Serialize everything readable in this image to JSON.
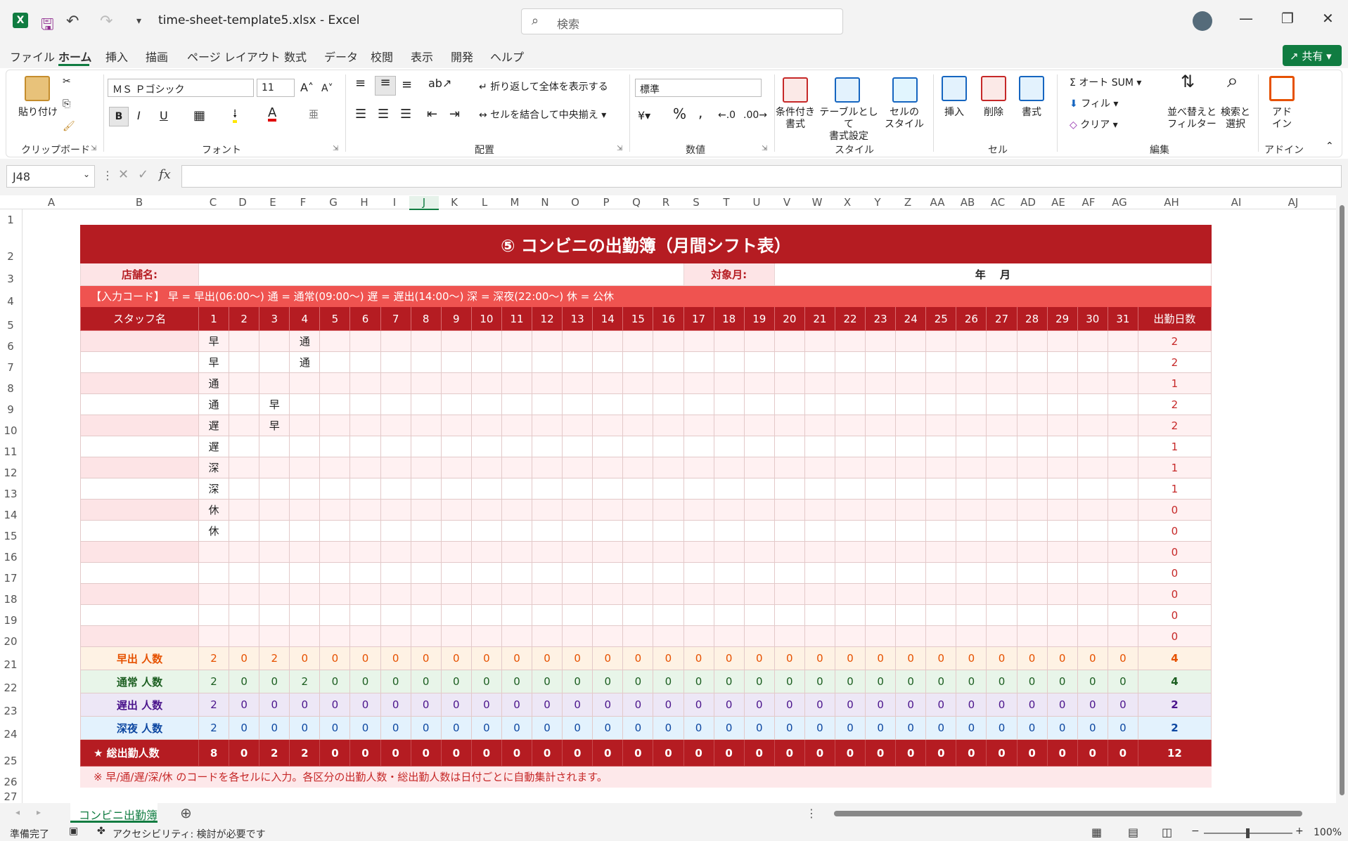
{
  "window": {
    "doc_title": "time-sheet-template5.xlsx  -  Excel",
    "search_placeholder": "検索"
  },
  "menu": [
    "ファイル",
    "ホーム",
    "挿入",
    "描画",
    "ページ レイアウト",
    "数式",
    "データ",
    "校閲",
    "表示",
    "開発",
    "ヘルプ"
  ],
  "share_label": "共有",
  "ribbon": {
    "clipboard": {
      "paste": "貼り付け",
      "label": "クリップボード"
    },
    "font": {
      "name": "ＭＳ Ｐゴシック",
      "size": "11",
      "label": "フォント",
      "bold": "B",
      "italic": "I",
      "underline": "U"
    },
    "alignment": {
      "wrap": "折り返して全体を表示する",
      "merge": "セルを結合して中央揃え",
      "label": "配置"
    },
    "number": {
      "format": "標準",
      "label": "数値"
    },
    "styles": {
      "cond": "条件付き\n書式",
      "table": "テーブルとして\n書式設定",
      "cell": "セルの\nスタイル",
      "label": "スタイル"
    },
    "cells": {
      "insert": "挿入",
      "delete": "削除",
      "format": "書式",
      "label": "セル"
    },
    "editing": {
      "autosum": "オート SUM",
      "fill": "フィル",
      "clear": "クリア",
      "sort": "並べ替えと\nフィルター",
      "find": "検索と\n選択",
      "label": "編集"
    },
    "addins": {
      "btn": "アド\nイン",
      "label": "アドイン"
    }
  },
  "namebox": "J48",
  "columns": [
    "A",
    "B",
    "C",
    "D",
    "E",
    "F",
    "G",
    "H",
    "I",
    "J",
    "K",
    "L",
    "M",
    "N",
    "O",
    "P",
    "Q",
    "R",
    "S",
    "T",
    "U",
    "V",
    "W",
    "X",
    "Y",
    "Z",
    "AA",
    "AB",
    "AC",
    "AD",
    "AE",
    "AF",
    "AG",
    "AH",
    "AI",
    "AJ"
  ],
  "rows": [
    "1",
    "2",
    "3",
    "4",
    "5",
    "6",
    "7",
    "8",
    "9",
    "10",
    "11",
    "12",
    "13",
    "14",
    "15",
    "16",
    "17",
    "18",
    "19",
    "20",
    "21",
    "22",
    "23",
    "24",
    "25",
    "26",
    "27"
  ],
  "sheet": {
    "title": "⑤ コンビニの出勤簿（月間シフト表）",
    "store_label": "店舗名:",
    "month_label": "対象月:",
    "year_month": "年　 月",
    "code_legend": "【入力コード】 早 = 早出(06:00～)  通 = 通常(09:00～)  遅 = 遅出(14:00～)  深 = 深夜(22:00～)  休 = 公休",
    "staff_header": "スタッフ名",
    "days_header": "出勤日数",
    "days": [
      "1",
      "2",
      "3",
      "4",
      "5",
      "6",
      "7",
      "8",
      "9",
      "10",
      "11",
      "12",
      "13",
      "14",
      "15",
      "16",
      "17",
      "18",
      "19",
      "20",
      "21",
      "22",
      "23",
      "24",
      "25",
      "26",
      "27",
      "28",
      "29",
      "30",
      "31"
    ],
    "staff_rows": [
      {
        "cells": {
          "1": "早",
          "4": "通"
        },
        "total": "2"
      },
      {
        "cells": {
          "1": "早",
          "4": "通"
        },
        "total": "2"
      },
      {
        "cells": {
          "1": "通"
        },
        "total": "1"
      },
      {
        "cells": {
          "1": "通",
          "3": "早"
        },
        "total": "2"
      },
      {
        "cells": {
          "1": "遅",
          "3": "早"
        },
        "total": "2"
      },
      {
        "cells": {
          "1": "遅"
        },
        "total": "1"
      },
      {
        "cells": {
          "1": "深"
        },
        "total": "1"
      },
      {
        "cells": {
          "1": "深"
        },
        "total": "1"
      },
      {
        "cells": {
          "1": "休"
        },
        "total": "0"
      },
      {
        "cells": {
          "1": "休"
        },
        "total": "0"
      },
      {
        "cells": {},
        "total": "0"
      },
      {
        "cells": {},
        "total": "0"
      },
      {
        "cells": {},
        "total": "0"
      },
      {
        "cells": {},
        "total": "0"
      },
      {
        "cells": {},
        "total": "0"
      }
    ],
    "count_rows": [
      {
        "cls": "early",
        "label": "早出 人数",
        "values": [
          "2",
          "0",
          "2",
          "0",
          "0",
          "0",
          "0",
          "0",
          "0",
          "0",
          "0",
          "0",
          "0",
          "0",
          "0",
          "0",
          "0",
          "0",
          "0",
          "0",
          "0",
          "0",
          "0",
          "0",
          "0",
          "0",
          "0",
          "0",
          "0",
          "0",
          "0"
        ],
        "total": "4"
      },
      {
        "cls": "normal",
        "label": "通常 人数",
        "values": [
          "2",
          "0",
          "0",
          "2",
          "0",
          "0",
          "0",
          "0",
          "0",
          "0",
          "0",
          "0",
          "0",
          "0",
          "0",
          "0",
          "0",
          "0",
          "0",
          "0",
          "0",
          "0",
          "0",
          "0",
          "0",
          "0",
          "0",
          "0",
          "0",
          "0",
          "0"
        ],
        "total": "4"
      },
      {
        "cls": "late",
        "label": "遅出 人数",
        "values": [
          "2",
          "0",
          "0",
          "0",
          "0",
          "0",
          "0",
          "0",
          "0",
          "0",
          "0",
          "0",
          "0",
          "0",
          "0",
          "0",
          "0",
          "0",
          "0",
          "0",
          "0",
          "0",
          "0",
          "0",
          "0",
          "0",
          "0",
          "0",
          "0",
          "0",
          "0"
        ],
        "total": "2"
      },
      {
        "cls": "night",
        "label": "深夜 人数",
        "values": [
          "2",
          "0",
          "0",
          "0",
          "0",
          "0",
          "0",
          "0",
          "0",
          "0",
          "0",
          "0",
          "0",
          "0",
          "0",
          "0",
          "0",
          "0",
          "0",
          "0",
          "0",
          "0",
          "0",
          "0",
          "0",
          "0",
          "0",
          "0",
          "0",
          "0",
          "0"
        ],
        "total": "2"
      }
    ],
    "total_row": {
      "label": "★ 総出勤人数",
      "values": [
        "8",
        "0",
        "2",
        "2",
        "0",
        "0",
        "0",
        "0",
        "0",
        "0",
        "0",
        "0",
        "0",
        "0",
        "0",
        "0",
        "0",
        "0",
        "0",
        "0",
        "0",
        "0",
        "0",
        "0",
        "0",
        "0",
        "0",
        "0",
        "0",
        "0",
        "0"
      ],
      "total": "12"
    },
    "note": "※ 早/通/遅/深/休 のコードを各セルに入力。各区分の出勤人数・総出勤人数は日付ごとに自動集計されます。"
  },
  "sheet_tab": "コンビニ出勤簿",
  "status": {
    "ready": "準備完了",
    "accessibility": "アクセシビリティ: 検討が必要です",
    "zoom": "100%"
  },
  "colors": {
    "brand_red": "#b51c22",
    "excel_green": "#107c41"
  }
}
